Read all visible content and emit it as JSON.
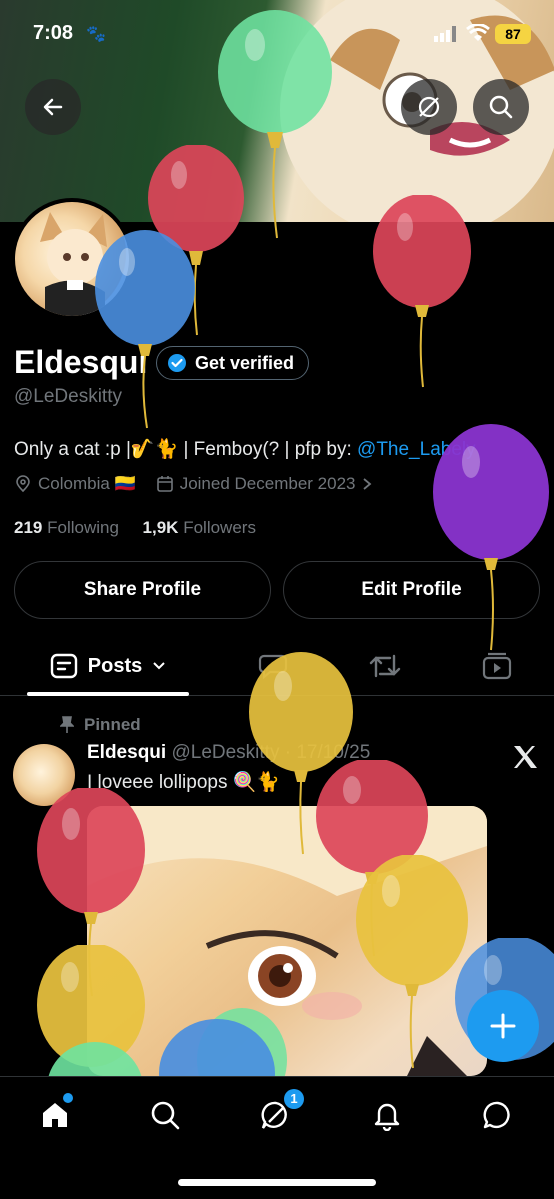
{
  "status_bar": {
    "time": "7:08",
    "battery": "87"
  },
  "profile": {
    "name": "Eldesqui",
    "verify_label": "Get verified",
    "handle": "@LeDeskitty",
    "bio_text": "Only a cat :p |🎷🐈 | Femboy(? | pfp by: ",
    "bio_mention": "@The_Labely",
    "location": "Colombia 🇨🇴",
    "joined": "Joined December 2023",
    "following_count": "219",
    "following_label": "Following",
    "followers_count": "1,9K",
    "followers_label": "Followers"
  },
  "actions": {
    "share": "Share Profile",
    "edit": "Edit Profile"
  },
  "tabs": {
    "posts_label": "Posts"
  },
  "post": {
    "pinned_label": "Pinned",
    "author": "Eldesqui",
    "meta": "@LeDeskitty · 17/10/25",
    "text": "I loveee lollipops 🍭🐈"
  },
  "bottom_nav": {
    "chat_badge": "1"
  },
  "colors": {
    "accent": "#1d9bf0",
    "background": "#000000",
    "muted": "#71767b"
  },
  "icons": [
    "back-arrow-icon",
    "grok-icon",
    "search-icon",
    "verified-badge-icon",
    "location-icon",
    "calendar-icon",
    "chevron-right-icon",
    "posts-icon",
    "chevron-down-icon",
    "reply-icon",
    "repost-icon",
    "media-icon",
    "pin-icon",
    "x-logo-icon",
    "plus-icon",
    "home-icon",
    "explore-icon",
    "grok-chat-icon",
    "bell-icon",
    "messages-icon"
  ]
}
